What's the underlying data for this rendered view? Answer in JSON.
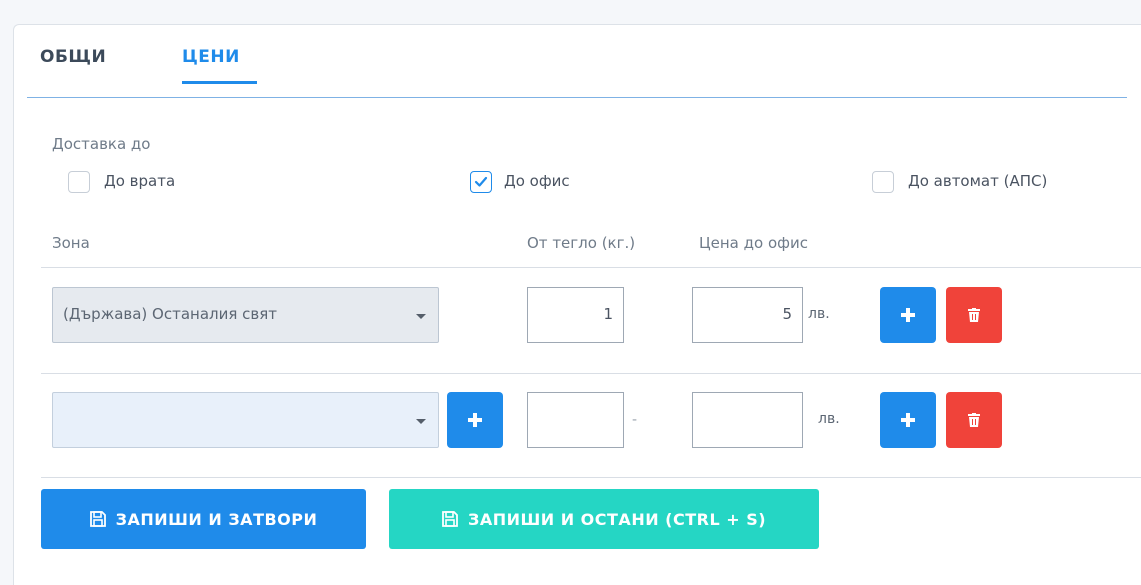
{
  "tabs": {
    "general": "ОБЩИ",
    "prices": "ЦЕНИ"
  },
  "delivery": {
    "label": "Доставка до",
    "options": [
      {
        "label": "До врата",
        "checked": false
      },
      {
        "label": "До офис",
        "checked": true
      },
      {
        "label": "До автомат (АПС)",
        "checked": false
      }
    ]
  },
  "table": {
    "headers": {
      "zone": "Зона",
      "weight": "От тегло (кг.)",
      "price": "Цена до офис"
    },
    "rows": [
      {
        "zone": "(Държава) Останалия свят",
        "weight": "1",
        "price": "5",
        "unit": "лв."
      },
      {
        "zone": "",
        "weight": "",
        "separator": "-",
        "price": "",
        "unit": "лв."
      }
    ]
  },
  "icons": {
    "add": "plus-icon",
    "delete": "trash-icon",
    "save": "floppy-disk-icon",
    "check": "checkmark-icon",
    "dropdown": "caret-down-icon"
  },
  "colors": {
    "primary": "#1f8bea",
    "danger": "#f0433a",
    "teal": "#25d6c4"
  },
  "buttons": {
    "save_close": "ЗАПИШИ И ЗАТВОРИ",
    "save_stay": "ЗАПИШИ И ОСТАНИ (CTRL + S)"
  }
}
